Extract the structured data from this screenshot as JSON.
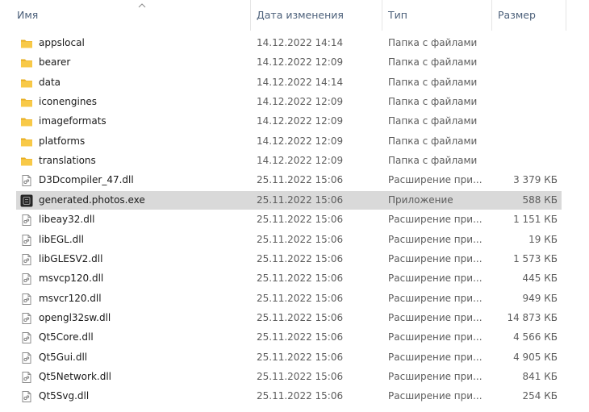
{
  "columns": {
    "name": "Имя",
    "date": "Дата изменения",
    "type": "Тип",
    "size": "Размер"
  },
  "sort": {
    "column": "name",
    "direction": "ascending",
    "icon": "chevron-up-icon"
  },
  "files": [
    {
      "name": "appslocal",
      "date": "14.12.2022 14:14",
      "type": "Папка с файлами",
      "size": "",
      "icon": "folder-icon"
    },
    {
      "name": "bearer",
      "date": "14.12.2022 12:09",
      "type": "Папка с файлами",
      "size": "",
      "icon": "folder-icon"
    },
    {
      "name": "data",
      "date": "14.12.2022 14:14",
      "type": "Папка с файлами",
      "size": "",
      "icon": "folder-icon"
    },
    {
      "name": "iconengines",
      "date": "14.12.2022 12:09",
      "type": "Папка с файлами",
      "size": "",
      "icon": "folder-icon"
    },
    {
      "name": "imageformats",
      "date": "14.12.2022 12:09",
      "type": "Папка с файлами",
      "size": "",
      "icon": "folder-icon"
    },
    {
      "name": "platforms",
      "date": "14.12.2022 12:09",
      "type": "Папка с файлами",
      "size": "",
      "icon": "folder-icon"
    },
    {
      "name": "translations",
      "date": "14.12.2022 12:09",
      "type": "Папка с файлами",
      "size": "",
      "icon": "folder-icon"
    },
    {
      "name": "D3Dcompiler_47.dll",
      "date": "25.11.2022 15:06",
      "type": "Расширение при...",
      "size": "3 379 КБ",
      "icon": "dll-file-icon"
    },
    {
      "name": "generated.photos.exe",
      "date": "25.11.2022 15:06",
      "type": "Приложение",
      "size": "588 КБ",
      "icon": "app-icon",
      "selected": true
    },
    {
      "name": "libeay32.dll",
      "date": "25.11.2022 15:06",
      "type": "Расширение при...",
      "size": "1 151 КБ",
      "icon": "dll-file-icon"
    },
    {
      "name": "libEGL.dll",
      "date": "25.11.2022 15:06",
      "type": "Расширение при...",
      "size": "19 КБ",
      "icon": "dll-file-icon"
    },
    {
      "name": "libGLESV2.dll",
      "date": "25.11.2022 15:06",
      "type": "Расширение при...",
      "size": "1 573 КБ",
      "icon": "dll-file-icon"
    },
    {
      "name": "msvcp120.dll",
      "date": "25.11.2022 15:06",
      "type": "Расширение при...",
      "size": "445 КБ",
      "icon": "dll-file-icon"
    },
    {
      "name": "msvcr120.dll",
      "date": "25.11.2022 15:06",
      "type": "Расширение при...",
      "size": "949 КБ",
      "icon": "dll-file-icon"
    },
    {
      "name": "opengl32sw.dll",
      "date": "25.11.2022 15:06",
      "type": "Расширение при...",
      "size": "14 873 КБ",
      "icon": "dll-file-icon"
    },
    {
      "name": "Qt5Core.dll",
      "date": "25.11.2022 15:06",
      "type": "Расширение при...",
      "size": "4 566 КБ",
      "icon": "dll-file-icon"
    },
    {
      "name": "Qt5Gui.dll",
      "date": "25.11.2022 15:06",
      "type": "Расширение при...",
      "size": "4 905 КБ",
      "icon": "dll-file-icon"
    },
    {
      "name": "Qt5Network.dll",
      "date": "25.11.2022 15:06",
      "type": "Расширение при...",
      "size": "841 КБ",
      "icon": "dll-file-icon"
    },
    {
      "name": "Qt5Svg.dll",
      "date": "25.11.2022 15:06",
      "type": "Расширение при...",
      "size": "254 КБ",
      "icon": "dll-file-icon"
    }
  ],
  "colors": {
    "folder": "#f8c948",
    "folder_dark": "#e7ad22",
    "selected_row": "#d9d9d9",
    "header_text": "#4c607a"
  }
}
